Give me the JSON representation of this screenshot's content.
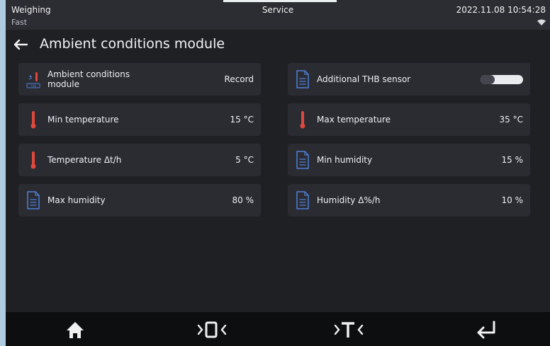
{
  "status_bar": {
    "mode": "Weighing",
    "profile": "Fast",
    "section": "Service",
    "datetime": "2022.11.08 10:54:28",
    "wifi_icon": "wifi-icon"
  },
  "header": {
    "back_icon": "back-arrow-icon",
    "title": "Ambient conditions module"
  },
  "tiles": [
    {
      "label": "Ambient conditions module",
      "value": "Record",
      "icon": "thb-sensor-icon"
    },
    {
      "label": "Additional THB sensor",
      "value": "",
      "toggle": false,
      "icon": "document-icon"
    },
    {
      "label": "Min temperature",
      "value": "15 °C",
      "icon": "thermometer-icon"
    },
    {
      "label": "Max temperature",
      "value": "35 °C",
      "icon": "thermometer-icon"
    },
    {
      "label": "Temperature Δt/h",
      "value": "5 °C",
      "icon": "thermometer-icon"
    },
    {
      "label": "Min humidity",
      "value": "15 %",
      "icon": "document-icon"
    },
    {
      "label": "Max humidity",
      "value": "80 %",
      "icon": "document-icon"
    },
    {
      "label": "Humidity Δ%/h",
      "value": "10 %",
      "icon": "document-icon"
    }
  ],
  "bottom_nav": [
    {
      "icon": "home-icon"
    },
    {
      "icon": "zero-icon"
    },
    {
      "icon": "tare-icon"
    },
    {
      "icon": "enter-icon"
    }
  ],
  "colors": {
    "background": "#1f2024",
    "tile": "#2b2c32",
    "icon_blue": "#4d7fd8",
    "accent_red": "#e0483e"
  }
}
